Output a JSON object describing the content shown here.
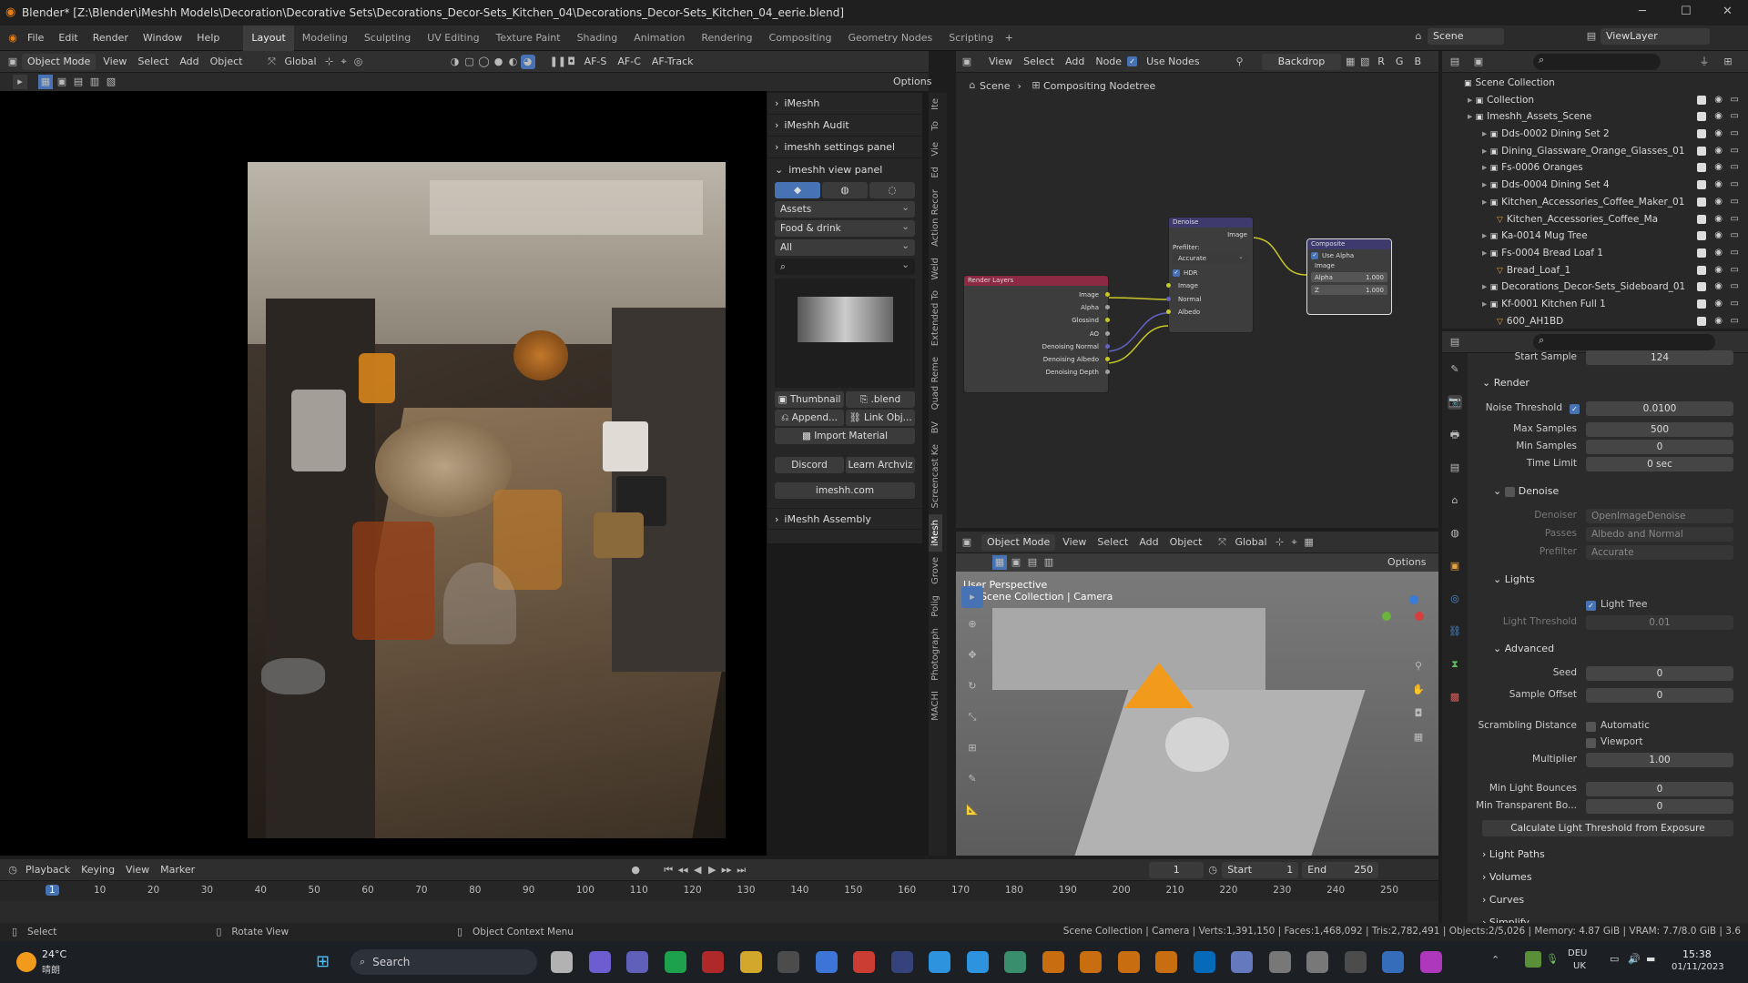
{
  "window": {
    "title": "Blender* [Z:\\Blender\\iMeshh Models\\Decoration\\Decorative Sets\\Decorations_Decor-Sets_Kitchen_04\\Decorations_Decor-Sets_Kitchen_04_eerie.blend]"
  },
  "menu": [
    "File",
    "Edit",
    "Render",
    "Window",
    "Help"
  ],
  "workspaces": [
    "Layout",
    "Modeling",
    "Sculpting",
    "UV Editing",
    "Texture Paint",
    "Shading",
    "Animation",
    "Rendering",
    "Compositing",
    "Geometry Nodes",
    "Scripting"
  ],
  "active_workspace": "Layout",
  "top_right": {
    "scene": "Scene",
    "viewlayer": "ViewLayer"
  },
  "viewport_header": {
    "mode": "Object Mode",
    "view": "View",
    "select": "Select",
    "add": "Add",
    "object": "Object",
    "transform": "Global",
    "af_s": "AF-S",
    "af_c": "AF-C",
    "af_track": "AF-Track",
    "options": "Options"
  },
  "npanel": {
    "sections": [
      "iMeshh",
      "iMeshh Audit",
      "imeshh settings panel",
      "imeshh view panel"
    ],
    "dropdowns": [
      "Assets",
      "Food & drink",
      "All"
    ],
    "thumbnail_label": "Thumbnail",
    "blend_label": ".blend",
    "append": "Append...",
    "link": "Link Obj...",
    "import_material": "Import Material",
    "discord": "Discord",
    "learn": "Learn Archviz",
    "site": "imeshh.com",
    "assembly": "iMeshh Assembly"
  },
  "side_tabs": [
    "Ite",
    "To",
    "Vie",
    "Ed",
    "Action Recor",
    "Weld",
    "Extended To",
    "Quad Reme",
    "BV",
    "Screencast Ke",
    "iMesh",
    "Grove",
    "Polig",
    "Photograph",
    "MACHI"
  ],
  "node_editor": {
    "view": "View",
    "select": "Select",
    "add": "Add",
    "node": "Node",
    "use_nodes": "Use Nodes",
    "backdrop": "Backdrop",
    "channels": [
      "R",
      "G",
      "B"
    ],
    "breadcrumb_scene": "Scene",
    "breadcrumb_tree": "Compositing Nodetree",
    "render_layers": {
      "title": "Render Layers",
      "outputs": [
        "Image",
        "Alpha",
        "Glossind",
        "AO",
        "Denoising Normal",
        "Denoising Albedo",
        "Denoising Depth"
      ]
    },
    "denoise": {
      "title": "Denoise",
      "output": "Image",
      "prefilter": "Prefilter:",
      "prefilter_value": "Accurate",
      "hdr": "HDR",
      "inputs": [
        "Image",
        "Normal",
        "Albedo"
      ]
    },
    "composite": {
      "title": "Composite",
      "use_alpha": "Use Alpha",
      "image": "Image",
      "alpha_label": "Alpha",
      "alpha_value": "1.000",
      "z_label": "Z",
      "z_value": "1.000"
    }
  },
  "viewport3d": {
    "mode": "Object Mode",
    "view": "View",
    "select": "Select",
    "add": "Add",
    "object": "Object",
    "transform": "Global",
    "options": "Options",
    "perspective": "User Perspective",
    "collection": "(1) Scene Collection | Camera"
  },
  "outliner": {
    "root": "Scene Collection",
    "items": [
      {
        "name": "Collection",
        "indent": 1
      },
      {
        "name": "Imeshh_Assets_Scene",
        "indent": 1
      },
      {
        "name": "Dds-0002 Dining Set 2",
        "indent": 2
      },
      {
        "name": "Dining_Glassware_Orange_Glasses_01",
        "indent": 2
      },
      {
        "name": "Fs-0006 Oranges",
        "indent": 2
      },
      {
        "name": "Dds-0004 Dining Set 4",
        "indent": 2
      },
      {
        "name": "Kitchen_Accessories_Coffee_Maker_01",
        "indent": 2
      },
      {
        "name": "Kitchen_Accessories_Coffee_Ma",
        "indent": 3
      },
      {
        "name": "Ka-0014 Mug Tree",
        "indent": 2
      },
      {
        "name": "Fs-0004 Bread Loaf 1",
        "indent": 2
      },
      {
        "name": "Bread_Loaf_1",
        "indent": 3
      },
      {
        "name": "Decorations_Decor-Sets_Sideboard_01",
        "indent": 2
      },
      {
        "name": "Kf-0001 Kitchen Full 1",
        "indent": 2
      },
      {
        "name": "600_AH1BD",
        "indent": 3
      }
    ]
  },
  "properties": {
    "start_sample": {
      "label": "Start Sample",
      "value": "124"
    },
    "render_section": "Render",
    "noise_threshold": {
      "label": "Noise Threshold",
      "value": "0.0100"
    },
    "max_samples": {
      "label": "Max Samples",
      "value": "500"
    },
    "min_samples": {
      "label": "Min Samples",
      "value": "0"
    },
    "time_limit": {
      "label": "Time Limit",
      "value": "0 sec"
    },
    "denoise_section": "Denoise",
    "denoiser": {
      "label": "Denoiser",
      "value": "OpenImageDenoise"
    },
    "passes": {
      "label": "Passes",
      "value": "Albedo and Normal"
    },
    "prefilter": {
      "label": "Prefilter",
      "value": "Accurate"
    },
    "lights_section": "Lights",
    "light_tree": "Light Tree",
    "light_threshold": {
      "label": "Light Threshold",
      "value": "0.01"
    },
    "advanced_section": "Advanced",
    "seed": {
      "label": "Seed",
      "value": "0"
    },
    "sample_offset": {
      "label": "Sample Offset",
      "value": "0"
    },
    "scrambling": {
      "label": "Scrambling Distance",
      "automatic": "Automatic",
      "viewport": "Viewport"
    },
    "multiplier": {
      "label": "Multiplier",
      "value": "1.00"
    },
    "min_light_bounces": {
      "label": "Min Light Bounces",
      "value": "0"
    },
    "min_transparent": {
      "label": "Min Transparent Bo...",
      "value": "0"
    },
    "calc_button": "Calculate Light Threshold from Exposure",
    "collapsed": [
      "Light Paths",
      "Volumes",
      "Curves",
      "Simplify"
    ]
  },
  "timeline": {
    "playback": "Playback",
    "keying": "Keying",
    "view": "View",
    "marker": "Marker",
    "current": "1",
    "start_label": "Start",
    "start": "1",
    "end_label": "End",
    "end": "250",
    "ticks": [
      "1",
      "10",
      "20",
      "30",
      "40",
      "50",
      "60",
      "70",
      "80",
      "90",
      "100",
      "110",
      "120",
      "130",
      "140",
      "150",
      "160",
      "170",
      "180",
      "190",
      "200",
      "210",
      "220",
      "230",
      "240",
      "250"
    ]
  },
  "statusbar": {
    "select": "Select",
    "rotate": "Rotate View",
    "context": "Object Context Menu",
    "info": "Scene Collection | Camera | Verts:1,391,150 | Faces:1,468,092 | Tris:2,782,491 | Objects:2/5,026 | Memory: 4.87 GiB | VRAM: 7.7/8.0 GiB | 3.6"
  },
  "taskbar": {
    "weather_temp": "24°C",
    "weather_desc": "晴朗",
    "search": "Search",
    "lang1": "DEU",
    "lang2": "UK",
    "time": "15:38",
    "date": "01/11/2023"
  }
}
